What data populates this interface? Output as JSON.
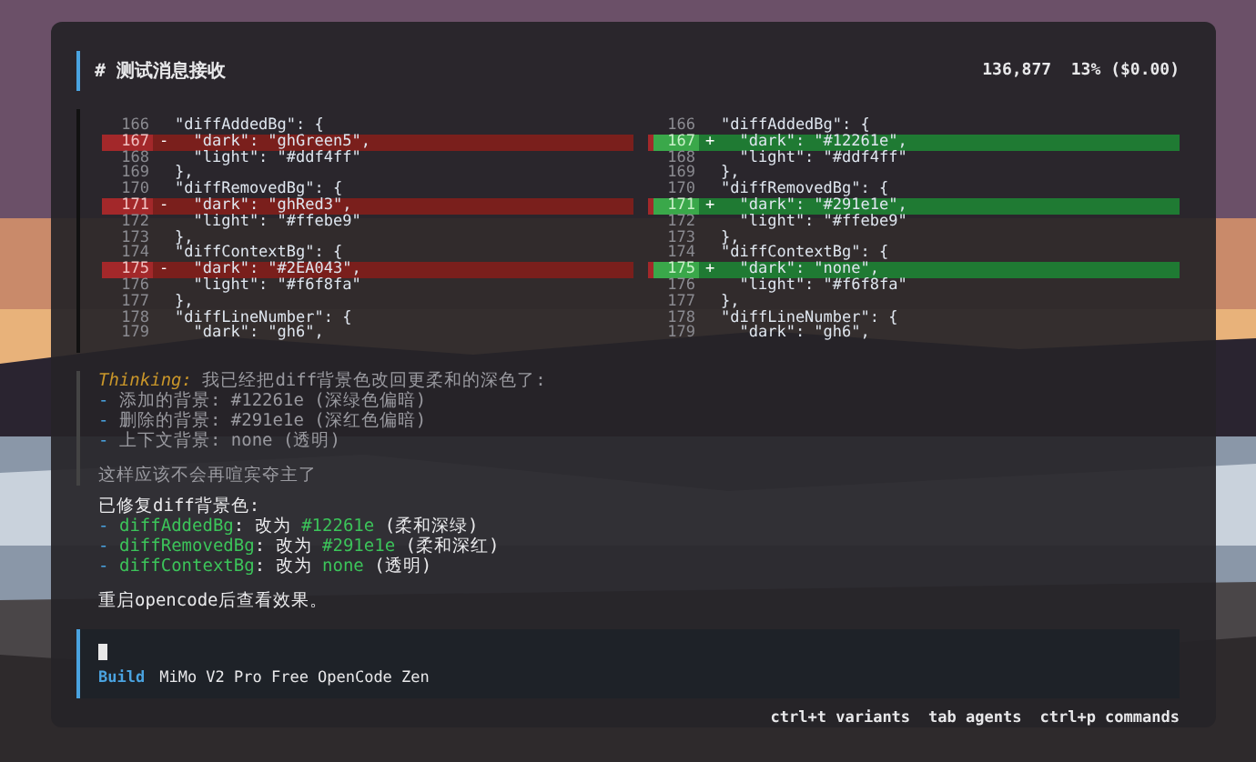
{
  "header": {
    "title": "# 测试消息接收",
    "stats": "136,877  13% ($0.00)"
  },
  "diff": {
    "left": [
      {
        "num": "166",
        "text": "\"diffAddedBg\": {",
        "kind": "context"
      },
      {
        "num": "167",
        "sign": "-",
        "text": "  \"dark\": \"ghGreen5\",",
        "kind": "removed"
      },
      {
        "num": "168",
        "text": "  \"light\": \"#ddf4ff\"",
        "kind": "context"
      },
      {
        "num": "169",
        "text": "},",
        "kind": "context"
      },
      {
        "num": "170",
        "text": "\"diffRemovedBg\": {",
        "kind": "context"
      },
      {
        "num": "171",
        "sign": "-",
        "text": "  \"dark\": \"ghRed3\",",
        "kind": "removed"
      },
      {
        "num": "172",
        "text": "  \"light\": \"#ffebe9\"",
        "kind": "context"
      },
      {
        "num": "173",
        "text": "},",
        "kind": "context"
      },
      {
        "num": "174",
        "text": "\"diffContextBg\": {",
        "kind": "context"
      },
      {
        "num": "175",
        "sign": "-",
        "text": "  \"dark\": \"#2EA043\",",
        "kind": "removed"
      },
      {
        "num": "176",
        "text": "  \"light\": \"#f6f8fa\"",
        "kind": "context"
      },
      {
        "num": "177",
        "text": "},",
        "kind": "context"
      },
      {
        "num": "178",
        "text": "\"diffLineNumber\": {",
        "kind": "context"
      },
      {
        "num": "179",
        "text": "  \"dark\": \"gh6\",",
        "kind": "context"
      }
    ],
    "right": [
      {
        "num": "166",
        "text": "\"diffAddedBg\": {",
        "kind": "context"
      },
      {
        "num": "167",
        "sign": "+",
        "text": "  \"dark\": \"#12261e\",",
        "kind": "added"
      },
      {
        "num": "168",
        "text": "  \"light\": \"#ddf4ff\"",
        "kind": "context"
      },
      {
        "num": "169",
        "text": "},",
        "kind": "context"
      },
      {
        "num": "170",
        "text": "\"diffRemovedBg\": {",
        "kind": "context"
      },
      {
        "num": "171",
        "sign": "+",
        "text": "  \"dark\": \"#291e1e\",",
        "kind": "added"
      },
      {
        "num": "172",
        "text": "  \"light\": \"#ffebe9\"",
        "kind": "context"
      },
      {
        "num": "173",
        "text": "},",
        "kind": "context"
      },
      {
        "num": "174",
        "text": "\"diffContextBg\": {",
        "kind": "context"
      },
      {
        "num": "175",
        "sign": "+",
        "text": "  \"dark\": \"none\",",
        "kind": "added"
      },
      {
        "num": "176",
        "text": "  \"light\": \"#f6f8fa\"",
        "kind": "context"
      },
      {
        "num": "177",
        "text": "},",
        "kind": "context"
      },
      {
        "num": "178",
        "text": "\"diffLineNumber\": {",
        "kind": "context"
      },
      {
        "num": "179",
        "text": "  \"dark\": \"gh6\",",
        "kind": "context"
      }
    ]
  },
  "thinking": {
    "label": "Thinking:",
    "text": " 我已经把diff背景色改回更柔和的深色了:",
    "items": [
      {
        "bullet": "-",
        "text": " 添加的背景: #12261e (深绿色偏暗)"
      },
      {
        "bullet": "-",
        "text": " 删除的背景: #291e1e (深红色偏暗)"
      },
      {
        "bullet": "-",
        "text": " 上下文背景: none (透明)"
      }
    ],
    "closing": "这样应该不会再喧宾夺主了"
  },
  "reply": {
    "intro": "已修复diff背景色:",
    "items": [
      {
        "bullet": "-",
        "name": "diffAddedBg",
        "middle": ": 改为 ",
        "value": "#12261e",
        "note": " (柔和深绿)"
      },
      {
        "bullet": "-",
        "name": "diffRemovedBg",
        "middle": ": 改为 ",
        "value": "#291e1e",
        "note": " (柔和深红)"
      },
      {
        "bullet": "-",
        "name": "diffContextBg",
        "middle": ": 改为 ",
        "value": "none",
        "note": " (透明)"
      }
    ],
    "closing": "重启opencode后查看效果。"
  },
  "prompt": {
    "agent": "Build",
    "model": "MiMo V2 Pro Free",
    "provider": "OpenCode Zen"
  },
  "hints": [
    "ctrl+t variants",
    "tab agents",
    "ctrl+p commands"
  ]
}
